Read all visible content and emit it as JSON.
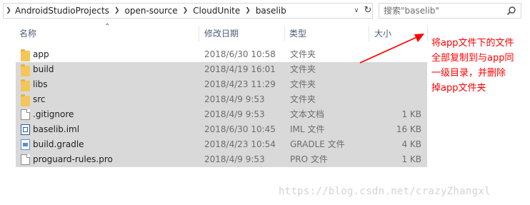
{
  "breadcrumb": {
    "items": [
      "AndroidStudioProjects",
      "open-source",
      "CloudUnite",
      "baselib"
    ]
  },
  "search": {
    "placeholder": "搜索\"baselib\""
  },
  "columns": {
    "name": "名称",
    "date": "修改日期",
    "type": "类型",
    "size": "大小"
  },
  "files": [
    {
      "name": "app",
      "date": "2018/6/30 10:58",
      "type": "文件夹",
      "size": "",
      "icon": "folder-icon",
      "selected": false
    },
    {
      "name": "build",
      "date": "2018/4/19 16:01",
      "type": "文件夹",
      "size": "",
      "icon": "folder-icon",
      "selected": true
    },
    {
      "name": "libs",
      "date": "2018/4/23 11:29",
      "type": "文件夹",
      "size": "",
      "icon": "folder-icon",
      "selected": true
    },
    {
      "name": "src",
      "date": "2018/4/9 9:53",
      "type": "文件夹",
      "size": "",
      "icon": "folder-icon",
      "selected": true
    },
    {
      "name": ".gitignore",
      "date": "2018/4/9 9:53",
      "type": "文本文档",
      "size": "1 KB",
      "icon": "text-file-icon",
      "selected": true
    },
    {
      "name": "baselib.iml",
      "date": "2018/6/30 10:45",
      "type": "IML 文件",
      "size": "16 KB",
      "icon": "iml-file-icon",
      "selected": true
    },
    {
      "name": "build.gradle",
      "date": "2018/4/23 10:54",
      "type": "GRADLE 文件",
      "size": "4 KB",
      "icon": "gradle-file-icon",
      "selected": true
    },
    {
      "name": "proguard-rules.pro",
      "date": "2018/4/9 9:53",
      "type": "PRO 文件",
      "size": "1 KB",
      "icon": "file-icon",
      "selected": true
    }
  ],
  "annotation": {
    "lines": [
      "将app文件下的文件",
      "全部复制到与app同",
      "一级目录，并删除",
      "掉app文件夹"
    ],
    "color": "#ff0000"
  },
  "watermark": "https://blog.csdn.net/crazyZhangxl",
  "colors": {
    "selection": "#d9d9d9",
    "header_text": "#4c607a",
    "folder": "#f4c65a"
  }
}
